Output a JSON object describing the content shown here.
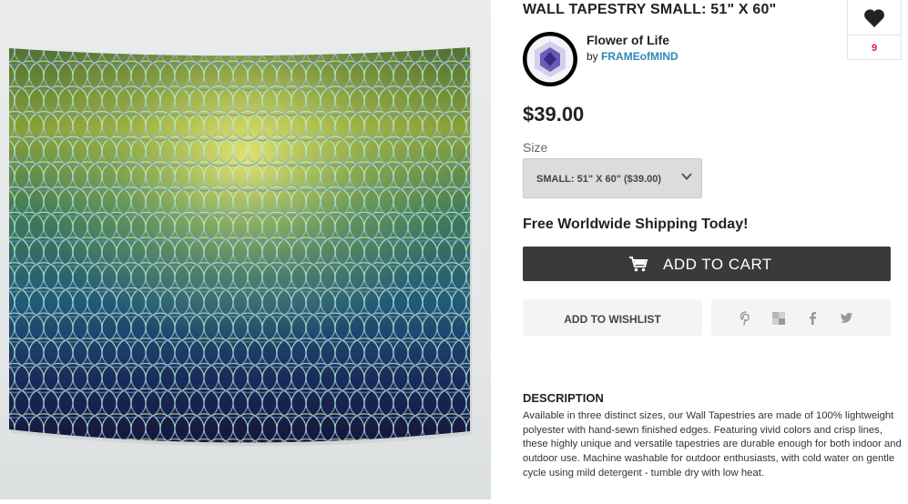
{
  "product": {
    "title": "WALL TAPESTRY SMALL: 51\" X 60\"",
    "artwork_title": "Flower of Life",
    "by_prefix": "by",
    "artist": "FRAMEofMIND",
    "price": "$39.00"
  },
  "favorites": {
    "icon": "heart-icon",
    "count": "9"
  },
  "size": {
    "label": "Size",
    "selected": "SMALL: 51\" X 60\" ($39.00)"
  },
  "shipping_text": "Free Worldwide Shipping Today!",
  "actions": {
    "add_to_cart": "ADD TO CART",
    "add_to_wishlist": "ADD TO WISHLIST"
  },
  "share_icons": [
    "pinterest-icon",
    "stumbleupon-icon",
    "facebook-icon",
    "twitter-icon"
  ],
  "description": {
    "heading": "DESCRIPTION",
    "body": "Available in three distinct sizes, our Wall Tapestries are made of 100% lightweight polyester with hand-sewn finished edges. Featuring vivid colors and crisp lines, these highly unique and versatile tapestries are durable enough for both indoor and outdoor use. Machine washable for outdoor enthusiasts, with cold water on gentle cycle using mild detergent - tumble dry with low heat."
  },
  "colors": {
    "cart_button": "#3a3a3a",
    "favorite_count": "#e0106b",
    "artist_link": "#2a8ab8"
  }
}
